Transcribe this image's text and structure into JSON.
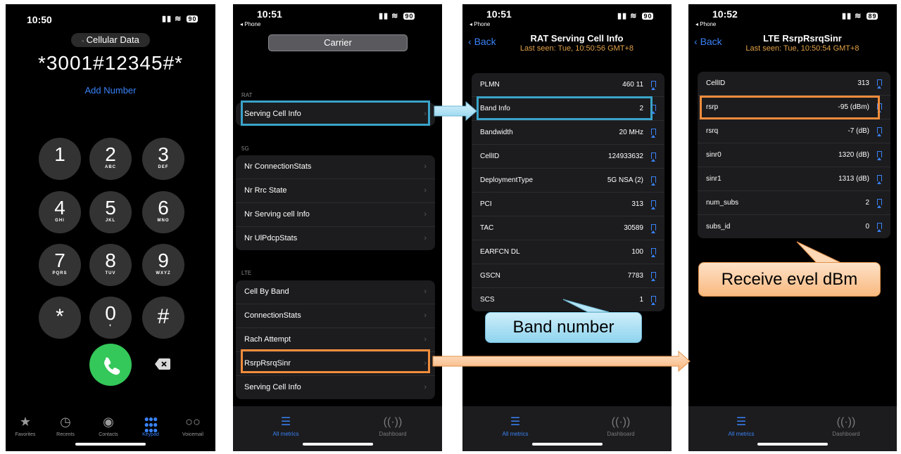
{
  "phone1": {
    "time": "10:50",
    "battery": "90",
    "cellular_label": "Cellular Data",
    "dialed": "*3001#12345#*",
    "add_number": "Add Number",
    "keys": [
      {
        "digit": "1",
        "letters": ""
      },
      {
        "digit": "2",
        "letters": "ABC"
      },
      {
        "digit": "3",
        "letters": "DEF"
      },
      {
        "digit": "4",
        "letters": "GHI"
      },
      {
        "digit": "5",
        "letters": "JKL"
      },
      {
        "digit": "6",
        "letters": "MNO"
      },
      {
        "digit": "7",
        "letters": "PQRS"
      },
      {
        "digit": "8",
        "letters": "TUV"
      },
      {
        "digit": "9",
        "letters": "WXYZ"
      },
      {
        "digit": "*",
        "letters": ""
      },
      {
        "digit": "0",
        "letters": "+"
      },
      {
        "digit": "#",
        "letters": ""
      }
    ],
    "tabs": [
      "Favorites",
      "Recents",
      "Contacts",
      "Keypad",
      "Voicemail"
    ],
    "active_tab": "Keypad"
  },
  "phone2": {
    "time": "10:51",
    "back_app": "◂ Phone",
    "battery": "90",
    "carrier": "Carrier",
    "sections": [
      {
        "title": "RAT",
        "items": [
          "Serving Cell Info"
        ]
      },
      {
        "title": "5G",
        "items": [
          "Nr ConnectionStats",
          "Nr Rrc State",
          "Nr Serving cell Info",
          "Nr UlPdcpStats"
        ]
      },
      {
        "title": "LTE",
        "items": [
          "Cell By Band",
          "ConnectionStats",
          "Rach Attempt",
          "RsrpRsrqSinr",
          "Serving Cell Info"
        ]
      }
    ],
    "tabs": [
      "All metrics",
      "Dashboard"
    ]
  },
  "phone3": {
    "time": "10:51",
    "back_app": "◂ Phone",
    "battery": "90",
    "back": "Back",
    "title": "RAT Serving Cell Info",
    "subtitle": "Last seen: Tue, 10:50:56 GMT+8",
    "rows": [
      {
        "name": "PLMN",
        "value": "460 11"
      },
      {
        "name": "Band Info",
        "value": "2"
      },
      {
        "name": "Bandwidth",
        "value": "20 MHz"
      },
      {
        "name": "CellID",
        "value": "124933632"
      },
      {
        "name": "DeploymentType",
        "value": "5G NSA (2)"
      },
      {
        "name": "PCI",
        "value": "313"
      },
      {
        "name": "TAC",
        "value": "30589"
      },
      {
        "name": "EARFCN DL",
        "value": "100"
      },
      {
        "name": "GSCN",
        "value": "7783"
      },
      {
        "name": "SCS",
        "value": "1"
      }
    ],
    "tabs": [
      "All metrics",
      "Dashboard"
    ]
  },
  "phone4": {
    "time": "10:52",
    "back_app": "◂ Phone",
    "battery": "89",
    "back": "Back",
    "title": "LTE RsrpRsrqSinr",
    "subtitle": "Last seen: Tue, 10:50:54 GMT+8",
    "rows": [
      {
        "name": "CellID",
        "value": "313"
      },
      {
        "name": "rsrp",
        "value": "-95 (dBm)"
      },
      {
        "name": "rsrq",
        "value": "-7 (dB)"
      },
      {
        "name": "sinr0",
        "value": "1320 (dB)"
      },
      {
        "name": "sinr1",
        "value": "1313 (dB)"
      },
      {
        "name": "num_subs",
        "value": "2"
      },
      {
        "name": "subs_id",
        "value": "0"
      }
    ],
    "tabs": [
      "All metrics",
      "Dashboard"
    ]
  },
  "annotations": {
    "band_number": "Band number",
    "receive_level": "Receive evel dBm"
  },
  "colors": {
    "highlight_blue": "#3aa3c9",
    "highlight_orange": "#f08c3c",
    "accent": "#3a82f7",
    "call_green": "#34c759"
  }
}
